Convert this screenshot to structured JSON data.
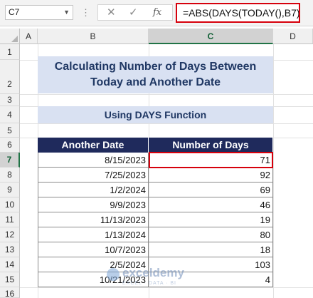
{
  "formula_bar": {
    "name_box": "C7",
    "dots": "⋮",
    "cancel_icon": "✕",
    "enter_icon": "✓",
    "fx_label": "fx",
    "formula": "=ABS(DAYS(TODAY(),B7))"
  },
  "columns": [
    "A",
    "B",
    "C",
    "D"
  ],
  "rows": [
    "1",
    "2",
    "3",
    "4",
    "5",
    "6",
    "7",
    "8",
    "9",
    "10",
    "11",
    "12",
    "13",
    "14",
    "15",
    "16"
  ],
  "selected_column": "C",
  "selected_row": "7",
  "sheet": {
    "title_line1": "Calculating Number of Days Between",
    "title_line2": "Today and Another Date",
    "subtitle": "Using DAYS Function",
    "headers": [
      "Another Date",
      "Number of Days"
    ],
    "data": [
      {
        "date": "8/15/2023",
        "days": "71"
      },
      {
        "date": "7/25/2023",
        "days": "92"
      },
      {
        "date": "1/2/2024",
        "days": "69"
      },
      {
        "date": "9/9/2023",
        "days": "46"
      },
      {
        "date": "11/13/2023",
        "days": "19"
      },
      {
        "date": "1/13/2024",
        "days": "80"
      },
      {
        "date": "10/7/2023",
        "days": "18"
      },
      {
        "date": "2/5/2024",
        "days": "103"
      },
      {
        "date": "10/21/2023",
        "days": "4"
      }
    ]
  },
  "watermark": {
    "name": "exceldemy",
    "tagline": "EXCEL · DATA · BI"
  },
  "colors": {
    "accent_red": "#d6000c",
    "header_navy": "#1f2a5c",
    "title_fill": "#d9e1f2",
    "title_text": "#203864"
  }
}
